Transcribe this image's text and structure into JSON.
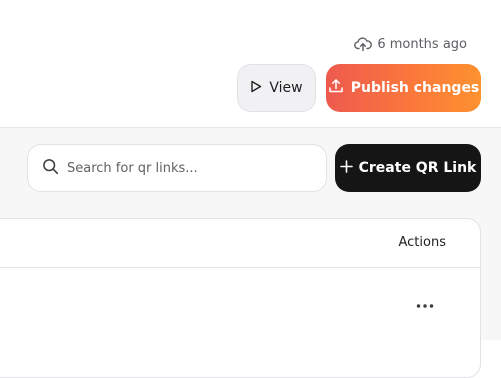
{
  "header": {
    "saved_status": "6 months ago",
    "view_label": "View",
    "publish_label": "Publish changes"
  },
  "toolbar": {
    "search_placeholder": "Search for qr links...",
    "search_value": "",
    "create_label": "Create QR Link"
  },
  "table": {
    "columns": [
      "Actions"
    ],
    "rows": [
      {
        "actions_icon": "more-horizontal-icon"
      }
    ]
  },
  "icons": {
    "saved": "cloud-upload-icon",
    "view": "play-outline-icon",
    "publish": "upload-tray-icon",
    "search": "search-icon",
    "create": "plus-icon"
  },
  "colors": {
    "publish_start": "#ee5a4f",
    "publish_end": "#fd9230",
    "create_bg": "#151515",
    "view_bg": "#f1f1f3"
  }
}
